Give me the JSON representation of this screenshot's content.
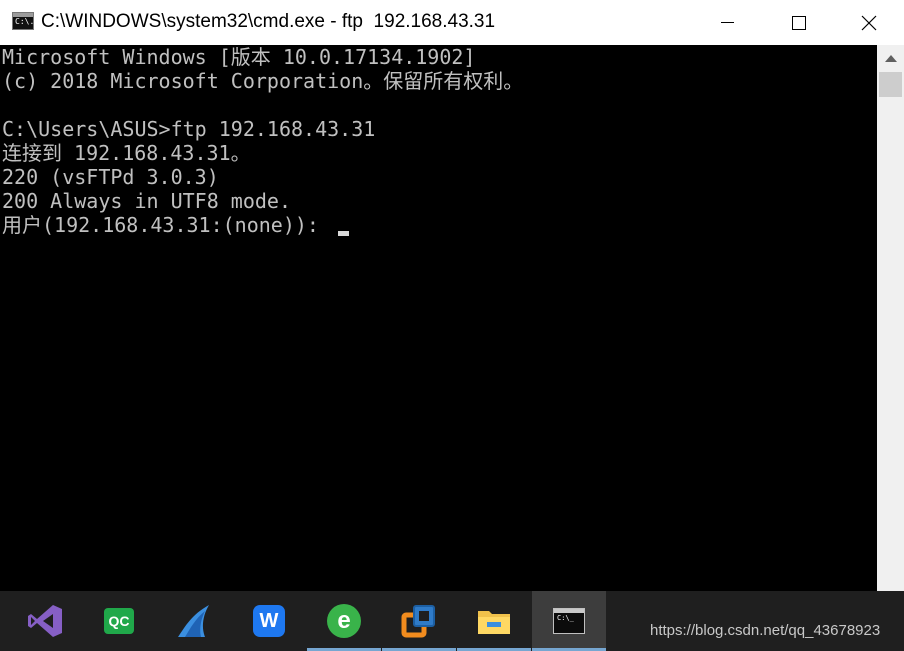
{
  "window": {
    "title": "C:\\WINDOWS\\system32\\cmd.exe - ftp  192.168.43.31",
    "app_icon_text": "C:\\.",
    "controls": [
      "minimize",
      "maximize",
      "close"
    ]
  },
  "console": {
    "lines": [
      "Microsoft Windows [版本 10.0.17134.1902]",
      "(c) 2018 Microsoft Corporation。保留所有权利。",
      "",
      "C:\\Users\\ASUS>ftp 192.168.43.31",
      "连接到 192.168.43.31。",
      "220 (vsFTPd 3.0.3)",
      "200 Always in UTF8 mode.",
      "用户(192.168.43.31:(none)): "
    ],
    "text_color": "#c0c0c0",
    "background": "#000000"
  },
  "taskbar": {
    "items": [
      {
        "name": "visual-studio",
        "icon": "vs-icon"
      },
      {
        "name": "qc",
        "icon": "qc-icon",
        "label": "QC"
      },
      {
        "name": "wireshark",
        "icon": "shark-fin-icon"
      },
      {
        "name": "wps",
        "icon": "wps-icon",
        "label": "W"
      },
      {
        "name": "internet-explorer",
        "icon": "ie-icon",
        "label": "e"
      },
      {
        "name": "virtualbox",
        "icon": "virtualbox-icon"
      },
      {
        "name": "file-explorer",
        "icon": "folder-icon"
      },
      {
        "name": "command-prompt",
        "icon": "cmd-icon",
        "label": "C:\\_",
        "active": true
      }
    ],
    "accent": "#76a6d1",
    "watermark": "https://blog.csdn.net/qq_43678923"
  }
}
